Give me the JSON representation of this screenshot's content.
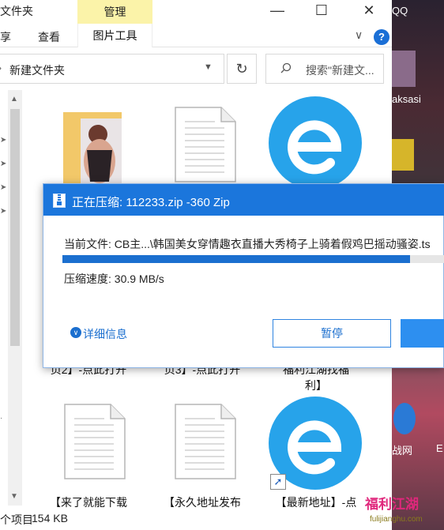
{
  "titlebar": {
    "title": "文件夹",
    "manage_tab": "管理",
    "minimize": "—",
    "maximize": "☐",
    "close": "✕"
  },
  "ribbon": {
    "home": "享",
    "view": "查看",
    "picture_tools": "图片工具",
    "expand": "∨",
    "help": "?"
  },
  "address": {
    "path": "新建文件夹",
    "refresh": "↻",
    "search_placeholder": "搜索\"新建文..."
  },
  "files": {
    "row2_partial": [
      "页2】-点此打开",
      "页3】-点此打开",
      "福利江湖找福",
      "利】"
    ],
    "row3": [
      "【来了就能下载",
      "【永久地址发布",
      "【最新地址】-点"
    ]
  },
  "status": {
    "items": "个项目",
    "size": "154 KB"
  },
  "desktop": {
    "qq": "QQ",
    "user": "aksasi",
    "app": "战网",
    "letter": "E",
    "watermark": "福利江湖",
    "watermark_url": "fulijianghu.com"
  },
  "dialog": {
    "title": "正在压缩: 112233.zip -360 Zip",
    "current_file": "当前文件: CB主...\\韩国美女穿情趣衣直播大秀椅子上骑着假鸡巴摇动骚姿.ts",
    "speed": "压缩速度: 30.9 MB/s",
    "progress": 0.91,
    "details": "详细信息",
    "pause": "暂停"
  },
  "colors": {
    "accent": "#1b76dc",
    "manage_tab": "#fbf3a9",
    "e_icon": "#27a3ea"
  }
}
